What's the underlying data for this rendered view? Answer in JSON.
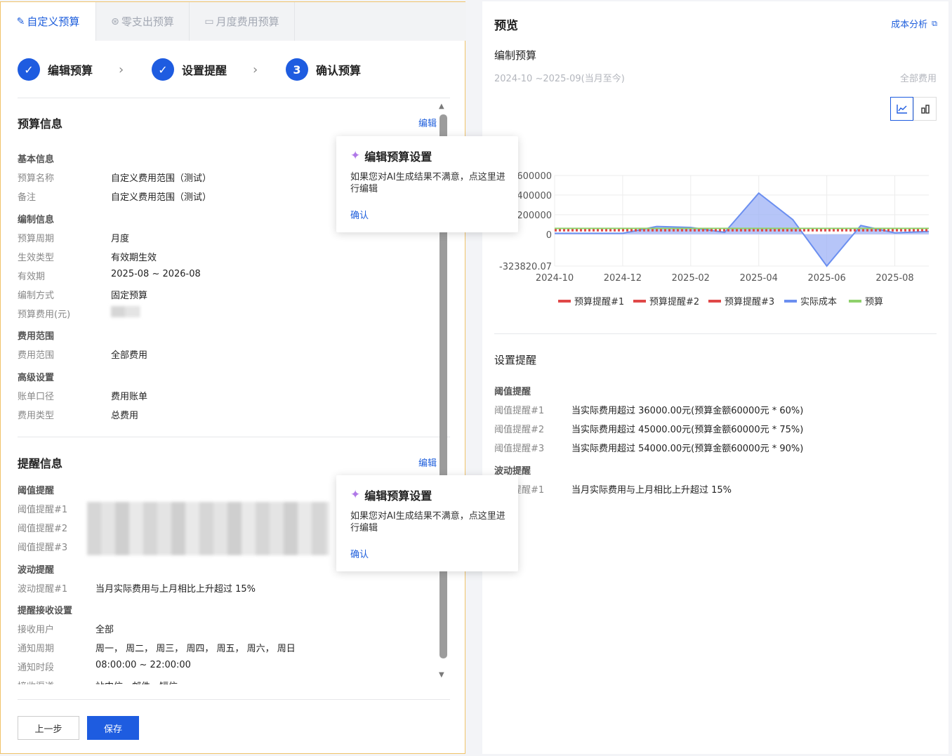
{
  "tabs": [
    {
      "label": "自定义预算",
      "icon": "pencil-icon",
      "active": true
    },
    {
      "label": "零支出预算",
      "icon": "yen-circle-icon",
      "active": false
    },
    {
      "label": "月度费用预算",
      "icon": "calendar-icon",
      "active": false
    }
  ],
  "steps": [
    {
      "label": "编辑预算",
      "marker": "✓",
      "state": "done"
    },
    {
      "label": "设置提醒",
      "marker": "✓",
      "state": "done"
    },
    {
      "label": "确认预算",
      "marker": "3",
      "state": "current"
    }
  ],
  "budget_info": {
    "title": "预算信息",
    "edit": "编辑",
    "basic_group": "基本信息",
    "name_label": "预算名称",
    "name_value": "自定义费用范围（测试）",
    "note_label": "备注",
    "note_value": "自定义费用范围（测试）",
    "compile_group": "编制信息",
    "period_label": "预算周期",
    "period_value": "月度",
    "effect_label": "生效类型",
    "effect_value": "有效期生效",
    "validity_label": "有效期",
    "validity_value": "2025-08 ~ 2026-08",
    "method_label": "编制方式",
    "method_value": "固定预算",
    "amount_label": "预算费用(元)",
    "scope_group": "费用范围",
    "scope_label": "费用范围",
    "scope_value": "全部费用",
    "adv_group": "高级设置",
    "bill_label": "账单口径",
    "bill_value": "费用账单",
    "type_label": "费用类型",
    "type_value": "总费用"
  },
  "alert_info": {
    "title": "提醒信息",
    "edit": "编辑",
    "threshold_group": "阈值提醒",
    "t1_label": "阈值提醒#1",
    "t2_label": "阈值提醒#2",
    "t3_label": "阈值提醒#3",
    "fluct_group": "波动提醒",
    "f1_label": "波动提醒#1",
    "f1_value": "当月实际费用与上月相比上升超过 15%",
    "recv_group": "提醒接收设置",
    "users_label": "接收用户",
    "users_value": "全部",
    "cycle_label": "通知周期",
    "cycle_value": "周一， 周二， 周三， 周四， 周五， 周六， 周日",
    "time_label": "通知时段",
    "time_value": "08:00:00 ~ 22:00:00",
    "channel_label": "接收渠道",
    "channel_value": "站内信、邮件、短信"
  },
  "popup": {
    "title": "编辑预算设置",
    "body": "如果您对AI生成结果不满意，点这里进行编辑",
    "confirm": "确认"
  },
  "buttons": {
    "prev": "上一步",
    "save": "保存"
  },
  "preview": {
    "title": "预览",
    "link": "成本分析",
    "subtitle": "编制预算",
    "date_range": "2024-10 ~2025-09(当月至今)",
    "scope": "全部费用",
    "alert_title": "设置提醒",
    "threshold_group": "阈值提醒",
    "thresholds": [
      {
        "label": "阈值提醒#1",
        "value": "当实际费用超过 36000.00元(预算金额60000元 * 60%)"
      },
      {
        "label": "阈值提醒#2",
        "value": "当实际费用超过 45000.00元(预算金额60000元 * 75%)"
      },
      {
        "label": "阈值提醒#3",
        "value": "当实际费用超过 54000.00元(预算金额60000元 * 90%)"
      }
    ],
    "fluct_group": "波动提醒",
    "fluct": [
      {
        "label": "波动提醒#1",
        "value": "当月实际费用与上月相比上升超过 15%"
      }
    ]
  },
  "chart_data": {
    "type": "area",
    "x": [
      "2024-10",
      "2024-11",
      "2024-12",
      "2025-01",
      "2025-02",
      "2025-03",
      "2025-04",
      "2025-05",
      "2025-06",
      "2025-07",
      "2025-08",
      "2025-09"
    ],
    "x_tick_labels": [
      "2024-10",
      "2024-12",
      "2025-02",
      "2025-04",
      "2025-06",
      "2025-08"
    ],
    "y_tick_labels": [
      "600000",
      "400000",
      "200000",
      "0",
      "-323820.07"
    ],
    "ylim": [
      -323820.07,
      600000
    ],
    "grid": true,
    "legend_position": "bottom",
    "series": [
      {
        "name": "预算提醒#1",
        "color": "#e04848",
        "style": "dotted",
        "values": [
          36000,
          36000,
          36000,
          36000,
          36000,
          36000,
          36000,
          36000,
          36000,
          36000,
          36000,
          36000
        ]
      },
      {
        "name": "预算提醒#2",
        "color": "#e04848",
        "style": "dotted",
        "values": [
          45000,
          45000,
          45000,
          45000,
          45000,
          45000,
          45000,
          45000,
          45000,
          45000,
          45000,
          45000
        ]
      },
      {
        "name": "预算提醒#3",
        "color": "#e04848",
        "style": "dotted",
        "values": [
          54000,
          54000,
          54000,
          54000,
          54000,
          54000,
          54000,
          54000,
          54000,
          54000,
          54000,
          54000
        ]
      },
      {
        "name": "实际成本",
        "color": "#6b8ff0",
        "style": "area",
        "values": [
          10000,
          10000,
          10000,
          80000,
          70000,
          20000,
          420000,
          150000,
          -323820.07,
          90000,
          15000,
          30000
        ]
      },
      {
        "name": "预算",
        "color": "#8fd16b",
        "style": "solid",
        "values": [
          60000,
          60000,
          60000,
          60000,
          60000,
          60000,
          60000,
          60000,
          60000,
          60000,
          60000,
          60000
        ]
      }
    ]
  }
}
